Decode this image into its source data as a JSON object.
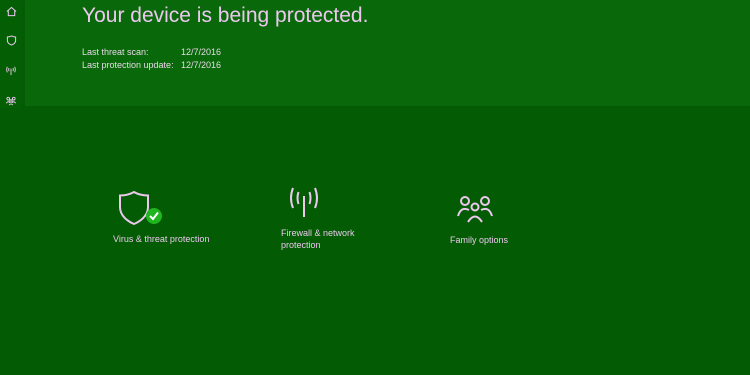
{
  "nav": {
    "items": [
      {
        "name": "home-icon",
        "label": "Home"
      },
      {
        "name": "shield-icon",
        "label": "Virus & threat protection"
      },
      {
        "name": "antenna-icon",
        "label": "Firewall & network protection"
      },
      {
        "name": "family-icon",
        "label": "Family options"
      }
    ]
  },
  "hero": {
    "title": "Your device is being protected.",
    "last_scan_label": "Last threat scan:",
    "last_scan_value": "12/7/2016",
    "last_update_label": "Last protection update:",
    "last_update_value": "12/7/2016"
  },
  "tiles": [
    {
      "label": "Virus & threat protection",
      "icon": "shield-check-icon",
      "status": "ok"
    },
    {
      "label": "Firewall & network protection",
      "icon": "antenna-icon"
    },
    {
      "label": "Family options",
      "icon": "family-icon"
    }
  ],
  "colors": {
    "background": "#035b03",
    "hero_background": "#096809",
    "text": "#ecc8ef",
    "status_ok": "#1fb51f"
  }
}
